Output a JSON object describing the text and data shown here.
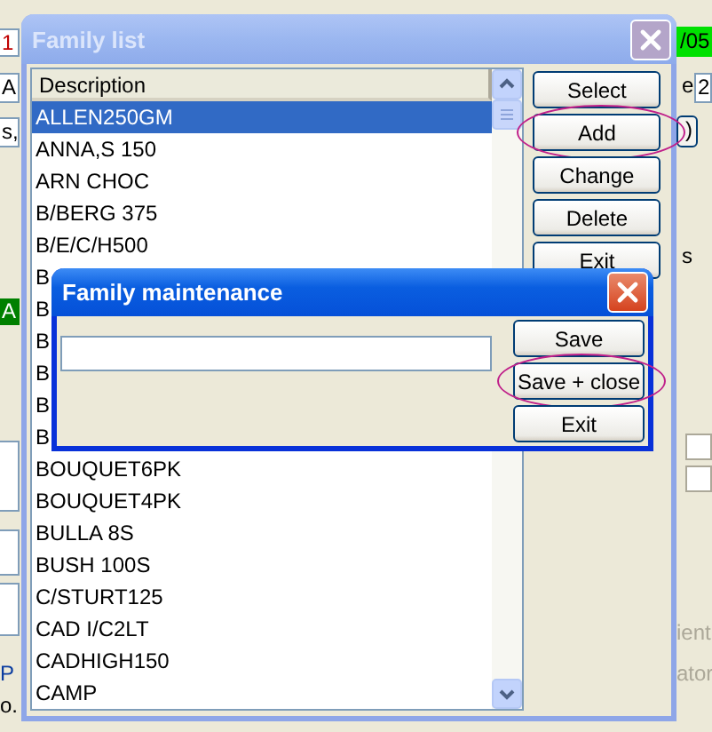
{
  "background_window": {
    "fragments": [
      {
        "kind": "alert-field",
        "text": "1"
      },
      {
        "kind": "green-field",
        "text": "/05"
      },
      {
        "kind": "field",
        "text": "A"
      },
      {
        "kind": "label",
        "text": "e"
      },
      {
        "kind": "field",
        "text": "2"
      },
      {
        "kind": "field",
        "text": "s,"
      },
      {
        "kind": "button",
        "text": ")"
      },
      {
        "kind": "label",
        "text": "s"
      },
      {
        "kind": "status-field",
        "text": "A"
      },
      {
        "kind": "checkbox",
        "checked": false
      },
      {
        "kind": "checkbox",
        "checked": false
      },
      {
        "kind": "field"
      },
      {
        "kind": "field"
      },
      {
        "kind": "field"
      },
      {
        "kind": "dim-label",
        "text": "ient"
      },
      {
        "kind": "link",
        "text": "P"
      },
      {
        "kind": "dim-label",
        "text": "ator"
      },
      {
        "kind": "label",
        "text": "o."
      }
    ]
  },
  "family_list": {
    "title": "Family list",
    "column": "Description",
    "rows": [
      {
        "text": "ALLEN250GM",
        "selected": true
      },
      {
        "text": "ANNA,S 150",
        "selected": false
      },
      {
        "text": "ARN CHOC",
        "selected": false
      },
      {
        "text": "B/BERG 375",
        "selected": false
      },
      {
        "text": "B/E/C/H500",
        "selected": false
      },
      {
        "text": "B",
        "selected": false
      },
      {
        "text": "B",
        "selected": false
      },
      {
        "text": "B",
        "selected": false
      },
      {
        "text": "B",
        "selected": false
      },
      {
        "text": "B",
        "selected": false
      },
      {
        "text": "B",
        "selected": false
      },
      {
        "text": "BOUQUET6PK",
        "selected": false
      },
      {
        "text": "BOUQUET4PK",
        "selected": false
      },
      {
        "text": "BULLA 8S",
        "selected": false
      },
      {
        "text": "BUSH 100S",
        "selected": false
      },
      {
        "text": "C/STURT125",
        "selected": false
      },
      {
        "text": "CAD I/C2LT",
        "selected": false
      },
      {
        "text": "CADHIGH150",
        "selected": false
      },
      {
        "text": "CAMP",
        "selected": false
      }
    ],
    "buttons": [
      {
        "label": "Select",
        "highlighted": false
      },
      {
        "label": "Add",
        "highlighted": true
      },
      {
        "label": "Change",
        "highlighted": false
      },
      {
        "label": "Delete",
        "highlighted": false
      },
      {
        "label": "Exit",
        "highlighted": false
      }
    ]
  },
  "family_maintenance": {
    "title": "Family maintenance",
    "buttons": [
      {
        "label": "Save",
        "highlighted": false
      },
      {
        "label": "Save + close",
        "highlighted": true
      },
      {
        "label": "Exit",
        "highlighted": false
      }
    ]
  }
}
